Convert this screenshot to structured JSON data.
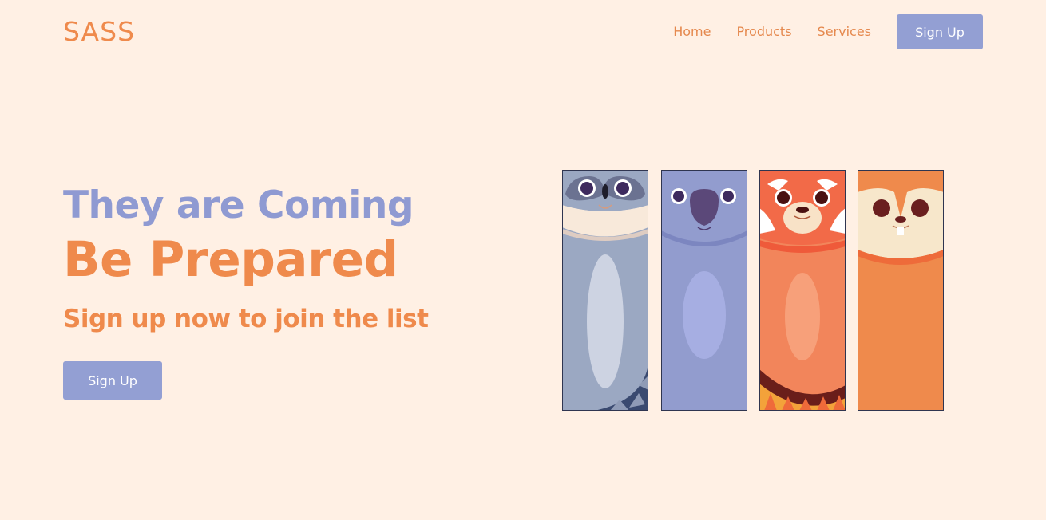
{
  "header": {
    "logo": "SASS",
    "nav": {
      "home": "Home",
      "products": "Products",
      "services": "Services",
      "signup": "Sign Up"
    }
  },
  "hero": {
    "title_line1": "They are Coming",
    "title_line2": "Be Prepared",
    "subtitle": "Sign up now to join the list",
    "cta": "Sign Up"
  },
  "colors": {
    "background": "#fff0e4",
    "accent_orange": "#ef8a4c",
    "accent_purple": "#939fd3"
  },
  "animals": [
    "raccoon-card",
    "koala-card",
    "red-panda-card",
    "squirrel-card"
  ]
}
